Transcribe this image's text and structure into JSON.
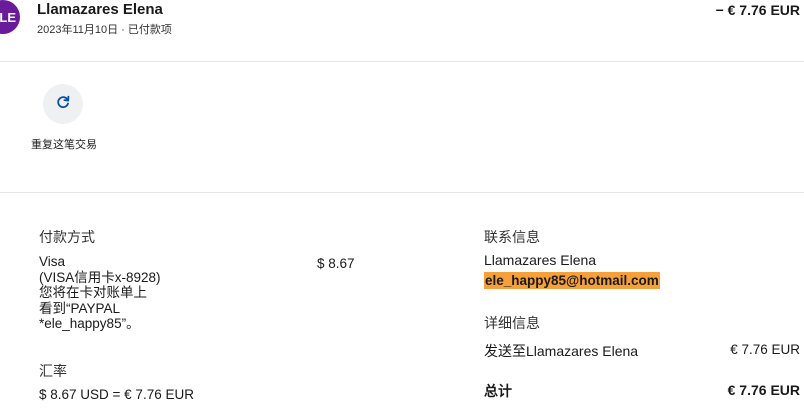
{
  "header": {
    "avatar_initials": "LE",
    "merchant_name": "Llamazares Elena",
    "meta": "2023年11月10日 · 已付款项",
    "amount": "− € 7.76 EUR"
  },
  "actions": {
    "repeat_label": "重复这笔交易"
  },
  "payment": {
    "title": "付款方式",
    "method_lines": [
      "Visa",
      "(VISA信用卡x-8928)",
      "您将在卡对账单上",
      "看到“PAYPAL",
      "*ele_happy85”。"
    ],
    "amount": "$ 8.67"
  },
  "exchange": {
    "title": "汇率",
    "value": "$ 8.67 USD = € 7.76 EUR"
  },
  "contact": {
    "title": "联系信息",
    "name": "Llamazares Elena",
    "email": "ele_happy85@hotmail.com"
  },
  "details": {
    "title": "详细信息",
    "ship_label": "发送至Llamazares Elena",
    "ship_amount": "€ 7.76 EUR",
    "total_label": "总计",
    "total_amount": "€ 7.76 EUR"
  },
  "colors": {
    "avatar_bg": "#6a1b9a",
    "email_highlight": "#f5a03a",
    "icon_blue": "#0a4ea8"
  }
}
